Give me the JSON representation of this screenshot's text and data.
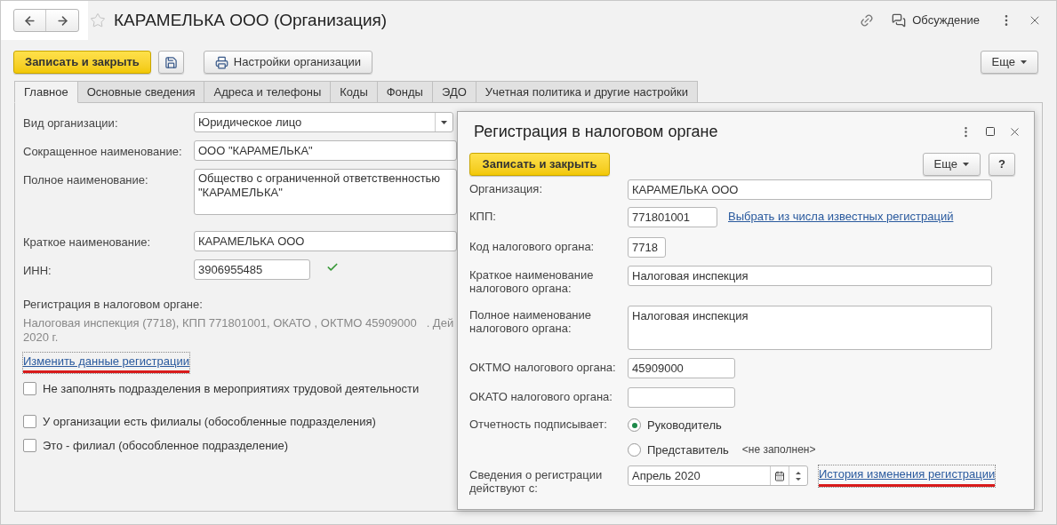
{
  "title": "КАРАМЕЛЬКА ООО (Организация)",
  "header": {
    "discussion": "Обсуждение"
  },
  "toolbar": {
    "save_close": "Записать и закрыть",
    "settings": "Настройки организации",
    "more": "Еще"
  },
  "tabs": [
    {
      "label": "Главное",
      "selected": true
    },
    {
      "label": "Основные сведения",
      "selected": false
    },
    {
      "label": "Адреса и телефоны",
      "selected": false
    },
    {
      "label": "Коды",
      "selected": false
    },
    {
      "label": "Фонды",
      "selected": false
    },
    {
      "label": "ЭДО",
      "selected": false
    },
    {
      "label": "Учетная политика и другие настройки",
      "selected": false
    }
  ],
  "form": {
    "fields": [
      {
        "kind": "select",
        "label": "Вид организации:",
        "value": "Юридическое лицо"
      },
      {
        "kind": "wide",
        "label": "Сокращенное наименование:",
        "value": "ООО \"КАРАМЕЛЬКА\""
      },
      {
        "kind": "multiline",
        "label": "Полное наименование:",
        "value": "Общество с ограниченной ответственностью\n\"КАРАМЕЛЬКА\""
      },
      {
        "kind": "wide",
        "label": "Краткое наименование:",
        "value": "КАРАМЕЛЬКА ООО"
      },
      {
        "kind": "short",
        "label": "ИНН:",
        "value": "3906955485",
        "valid": true
      }
    ],
    "registration": {
      "heading": "Регистрация в налоговом органе:",
      "lines": [
        "Налоговая инспекция (7718), КПП 771801001, ОКАТО , ОКТМО 45909000   . Дей",
        "2020 г."
      ],
      "link": {
        "text": "Изменить данные регистрации",
        "highlighted": true
      }
    },
    "checkboxes": [
      {
        "label": "Не заполнять подразделения в мероприятиях трудовой деятельности",
        "checked": false
      },
      {
        "label": "У организации есть филиалы (обособленные подразделения)",
        "checked": false
      },
      {
        "label": "Это - филиал (обособленное подразделение)",
        "checked": false
      }
    ]
  },
  "dialog": {
    "title": "Регистрация в налоговом органе",
    "save_close": "Записать и закрыть",
    "more": "Еще",
    "help": "?",
    "rows": [
      {
        "kind": "wide",
        "label": "Организация:",
        "value": "КАРАМЕЛЬКА ООО"
      },
      {
        "kind": "short",
        "label": "КПП:",
        "value": "771801001",
        "link": {
          "text": "Выбрать из числа известных регистраций",
          "highlighted": false
        }
      },
      {
        "kind": "tiny",
        "label": "Код налогового органа:",
        "value": "7718"
      },
      {
        "kind": "wide",
        "label": "Краткое наименование\nналогового органа:",
        "value": "Налоговая инспекция"
      },
      {
        "kind": "multiline",
        "label": "Полное наименование\nналогового органа:",
        "value": "Налоговая инспекция"
      },
      {
        "kind": "medium",
        "label": "ОКТМО налогового органа:",
        "value": "45909000"
      },
      {
        "kind": "medium",
        "label": "ОКАТО налогового органа:"
      },
      {
        "kind": "radio",
        "label": "Отчетность подписывает:",
        "options": [
          {
            "label": "Руководитель",
            "selected": true
          },
          {
            "label": "Представитель",
            "selected": false,
            "note": "<не заполнен>"
          }
        ]
      },
      {
        "kind": "date",
        "label": "Сведения о регистрации\nдействуют с:",
        "value": "Апрель 2020",
        "link": {
          "text": "История изменения регистрации",
          "highlighted": true
        }
      }
    ]
  }
}
